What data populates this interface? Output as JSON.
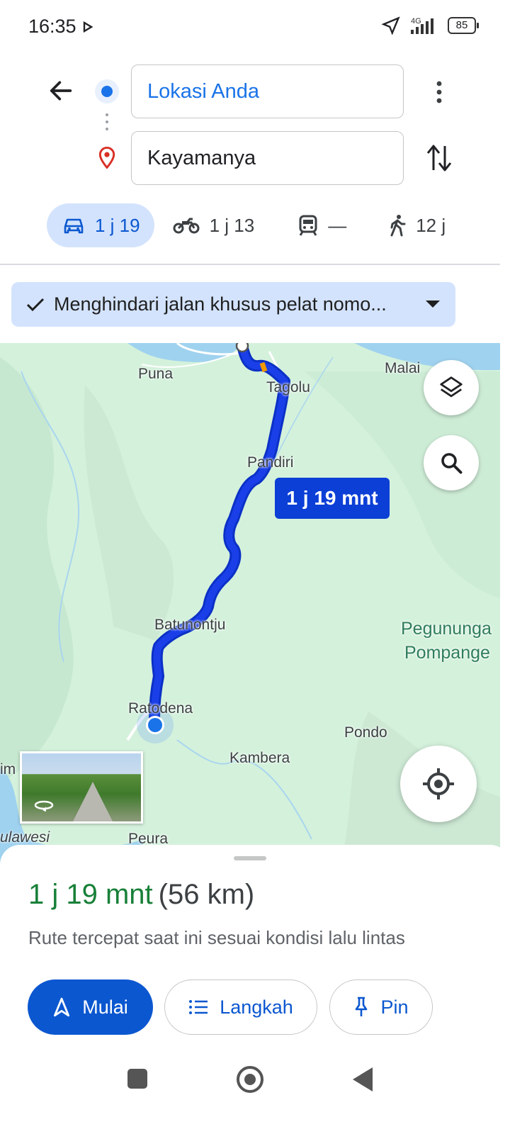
{
  "status_bar": {
    "time": "16:35",
    "network": "4G",
    "battery": "85"
  },
  "directions": {
    "origin": "Lokasi Anda",
    "destination": "Kayamanya"
  },
  "travel_modes": [
    {
      "mode": "car",
      "icon": "car-icon",
      "label": "1 j 19",
      "selected": true
    },
    {
      "mode": "motorcycle",
      "icon": "motorcycle-icon",
      "label": "1 j 13",
      "selected": false
    },
    {
      "mode": "transit",
      "icon": "train-icon",
      "label": "—",
      "selected": false
    },
    {
      "mode": "walk",
      "icon": "walking-icon",
      "label": "12 j",
      "selected": false
    }
  ],
  "filter_chip": {
    "label": "Menghindari jalan khusus pelat nomo..."
  },
  "map": {
    "route_eta": "1 j 19 mnt",
    "places": {
      "puna": "Puna",
      "malai": "Malai",
      "tagolu": "Tagolu",
      "pandiri": "Pandiri",
      "batunontju": "Batunontju",
      "ratodena": "Ratodena",
      "pondo": "Pondo",
      "kambera": "Kambera",
      "peura": "Peura",
      "ulawesi": "ulawesi",
      "im": "im",
      "pegunungan_1": "Pegununga",
      "pegunungan_2": "Pompange"
    },
    "route_color": "#1a3fe8"
  },
  "summary": {
    "duration": "1 j 19 mnt",
    "distance": "(56 km)",
    "note": "Rute tercepat saat ini sesuai kondisi lalu lintas"
  },
  "actions": {
    "start": "Mulai",
    "steps": "Langkah",
    "pin": "Pin"
  },
  "colors": {
    "accent": "#0b57d0",
    "duration_green": "#188038",
    "map_bg": "#d4f1dc"
  }
}
